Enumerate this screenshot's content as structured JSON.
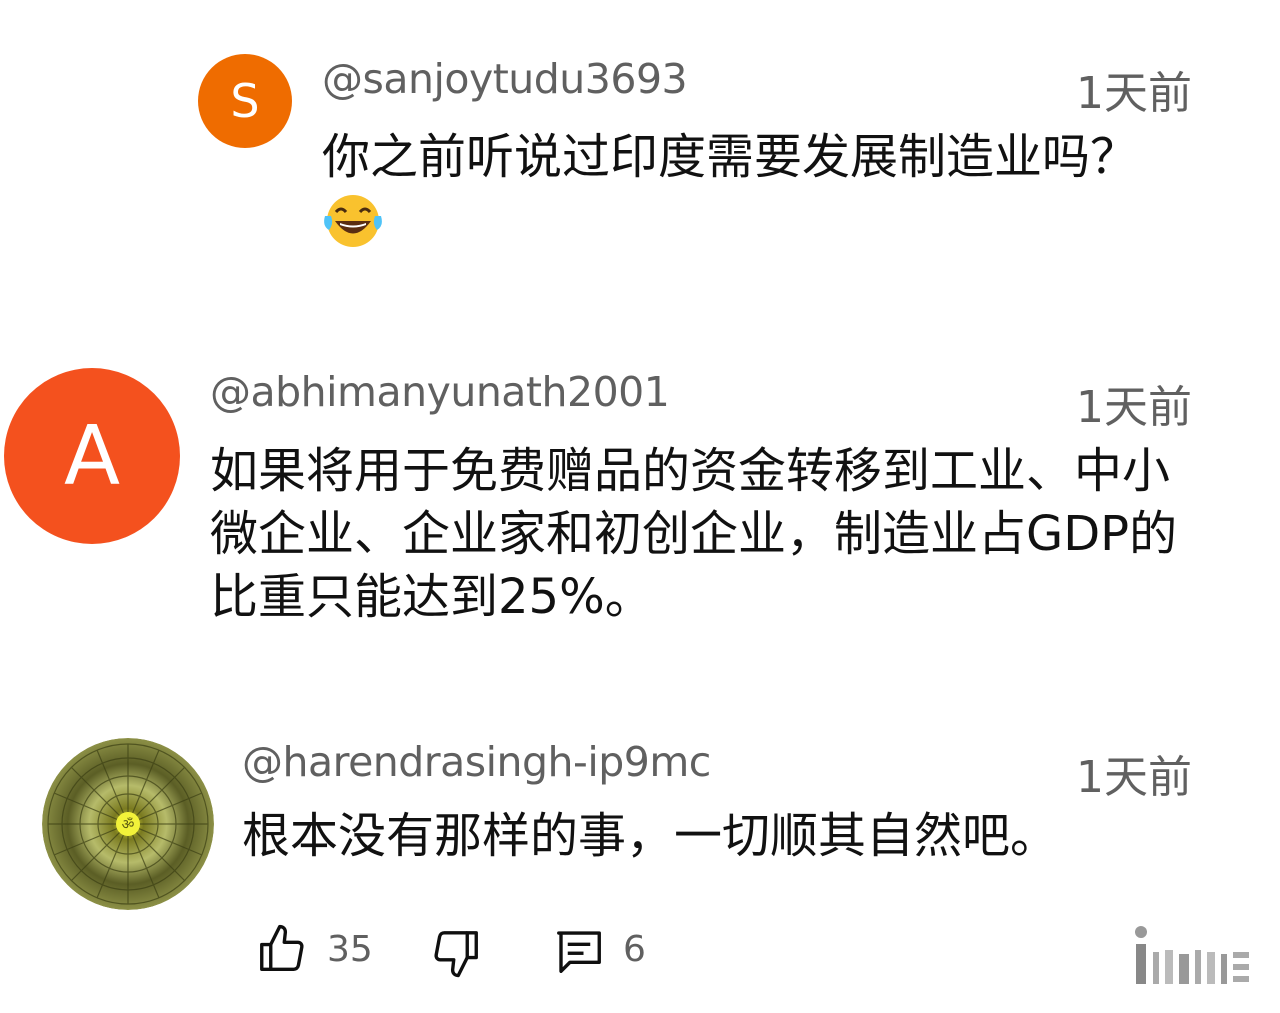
{
  "comments": [
    {
      "handle": "@sanjoytudu3693",
      "time": "1天前",
      "avatar_letter": "S",
      "avatar_color": "#ef6c00",
      "text": "你之前听说过印度需要发展制造业吗？",
      "emoji": "face-with-tears-of-joy"
    },
    {
      "handle": "@abhimanyunath2001",
      "time": "1天前",
      "avatar_letter": "A",
      "avatar_color": "#f4511e",
      "text": "如果将用于免费赠品的资金转移到工业、中小微企业、企业家和初创企业，制造业占GDP的比重只能达到25%。"
    },
    {
      "handle": "@harendrasingh-ip9mc",
      "time": "1天前",
      "avatar_image": "green-mandala-pattern",
      "text": "根本没有那样的事，一切顺其自然吧。"
    }
  ],
  "actions": {
    "like_count": "35",
    "reply_count": "6",
    "like_icon": "thumb-up-icon",
    "dislike_icon": "thumb-down-icon",
    "reply_icon": "comment-icon"
  },
  "colors": {
    "secondary_text": "#606060",
    "primary_text": "#111111"
  }
}
